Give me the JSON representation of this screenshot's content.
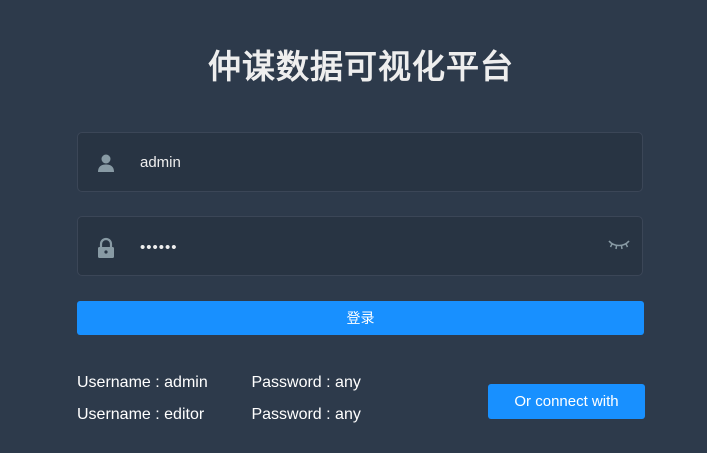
{
  "title": "仲谋数据可视化平台",
  "form": {
    "username": {
      "value": "admin",
      "icon": "user-icon"
    },
    "password": {
      "value": "••••••",
      "icon": "lock-icon",
      "toggle_icon": "eye-closed-icon"
    },
    "login_label": "登录"
  },
  "tips": [
    {
      "username": "Username : admin",
      "password": "Password : any"
    },
    {
      "username": "Username : editor",
      "password": "Password : any"
    }
  ],
  "connect_label": "Or connect with",
  "colors": {
    "background": "#2d3a4b",
    "input_bg": "#283443",
    "accent": "#1890ff",
    "icon": "#889aa4"
  }
}
